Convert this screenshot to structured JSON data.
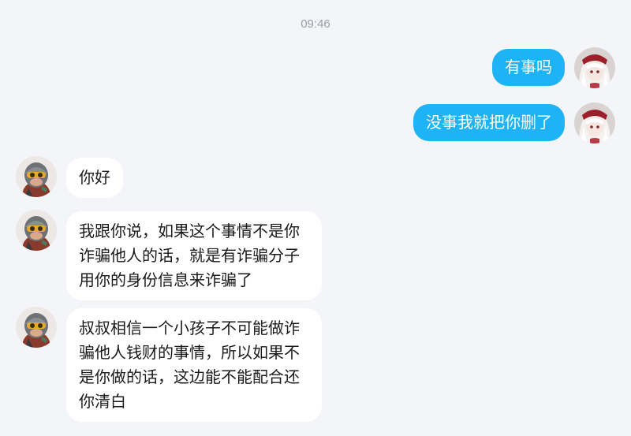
{
  "timestamp": "09:46",
  "colors": {
    "background": "#f3f5f8",
    "outgoing_bubble": "#1eb3f4",
    "incoming_bubble": "#ffffff",
    "timestamp_text": "#9aa0a6"
  },
  "messages": [
    {
      "direction": "outgoing",
      "text": "有事吗",
      "avatar": "white-haired-girl-avatar"
    },
    {
      "direction": "outgoing",
      "text": "没事我就把你删了",
      "avatar": "white-haired-girl-avatar"
    },
    {
      "direction": "incoming",
      "text": "你好",
      "avatar": "helmeted-character-avatar"
    },
    {
      "direction": "incoming",
      "text": "我跟你说，如果这个事情不是你诈骗他人的话，就是有诈骗分子用你的身份信息来诈骗了",
      "avatar": "helmeted-character-avatar"
    },
    {
      "direction": "incoming",
      "text": "叔叔相信一个小孩子不可能做诈骗他人钱财的事情，所以如果不是你做的话，这边能不能配合还你清白",
      "avatar": "helmeted-character-avatar"
    }
  ]
}
